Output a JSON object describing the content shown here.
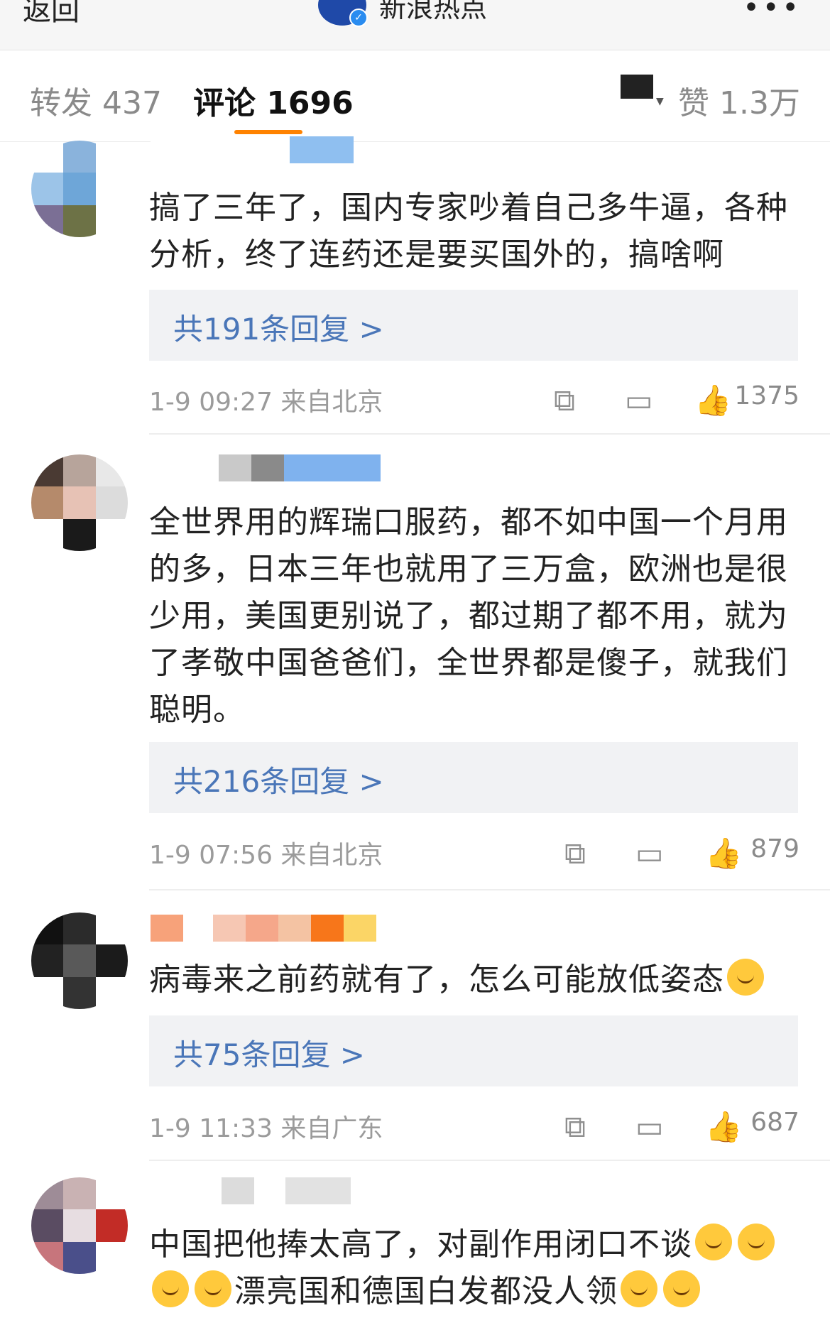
{
  "nav": {
    "back_label": "返回",
    "account_name": "新浪热点",
    "more_label": "•••"
  },
  "tabs": {
    "repost": "转发 437",
    "comment": "评论 1696",
    "like": "赞 1.3万"
  },
  "comments": [
    {
      "text": "搞了三年了，国内专家吵着自己多牛逼，各种分析，终了连药还是要买国外的，搞啥啊",
      "replies": "共191条回复 >",
      "time": "1-9 09:27  来自北京",
      "likes": "1375"
    },
    {
      "text": "全世界用的辉瑞口服药，都不如中国一个月用的多，日本三年也就用了三万盒，欧洲也是很少用，美国更别说了，都过期了都不用，就为了孝敬中国爸爸们，全世界都是傻子，就我们聪明。",
      "replies": "共216条回复 >",
      "time": "1-9 07:56  来自北京",
      "likes": "879"
    },
    {
      "text": "病毒来之前药就有了，怎么可能放低姿态",
      "replies": "共75条回复 >",
      "time": "1-9 11:33  来自广东",
      "likes": "687"
    },
    {
      "text_a": "中国把他捧太高了，对副作用闭口不谈",
      "text_b": "漂亮国和德国白发都没人领"
    }
  ],
  "icons": {
    "share": "share-icon",
    "comment": "comment-icon",
    "like": "thumbs-up-icon",
    "sort": "sort-icon"
  }
}
